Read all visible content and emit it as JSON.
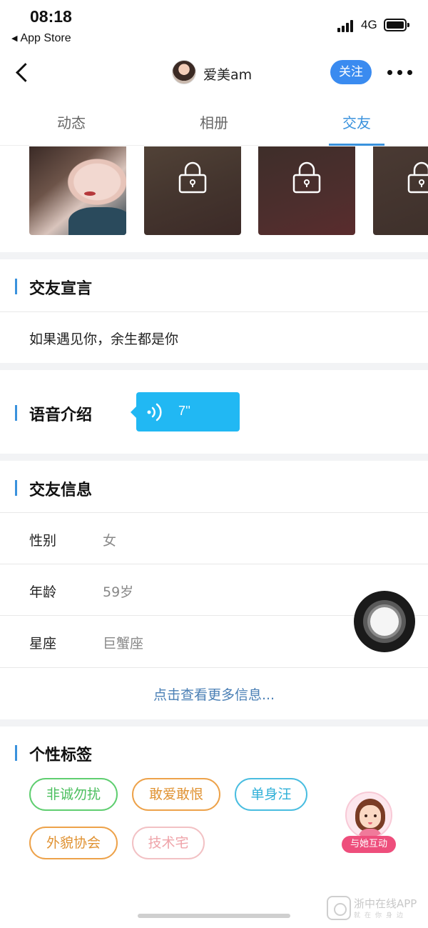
{
  "status_bar": {
    "time": "08:18",
    "back_app": "App Store",
    "network": "4G"
  },
  "nav": {
    "username": "爱美am",
    "follow_label": "关注"
  },
  "tabs": [
    {
      "label": "动态",
      "active": false
    },
    {
      "label": "相册",
      "active": false
    },
    {
      "label": "交友",
      "active": true
    }
  ],
  "sections": {
    "declaration": {
      "title": "交友宣言",
      "text": "如果遇见你，余生都是你"
    },
    "voice": {
      "title": "语音介绍",
      "duration": "7''"
    },
    "info": {
      "title": "交友信息",
      "rows": [
        {
          "key": "性别",
          "value": "女"
        },
        {
          "key": "年龄",
          "value": "59岁"
        },
        {
          "key": "星座",
          "value": "巨蟹座"
        }
      ],
      "more_link": "点击查看更多信息..."
    },
    "tags": {
      "title": "个性标签",
      "items": [
        "非诚勿扰",
        "敢爱敢恨",
        "单身汪",
        "外貌协会",
        "技术宅"
      ]
    }
  },
  "interact": {
    "label": "与她互动"
  },
  "watermark": {
    "title": "浙中在线APP",
    "subtitle": "就在你身边"
  },
  "colors": {
    "accent": "#3a92dd",
    "follow_button": "#3a8bf0",
    "voice_bubble": "#21b8f3",
    "interact_label": "#ee4e7c"
  }
}
